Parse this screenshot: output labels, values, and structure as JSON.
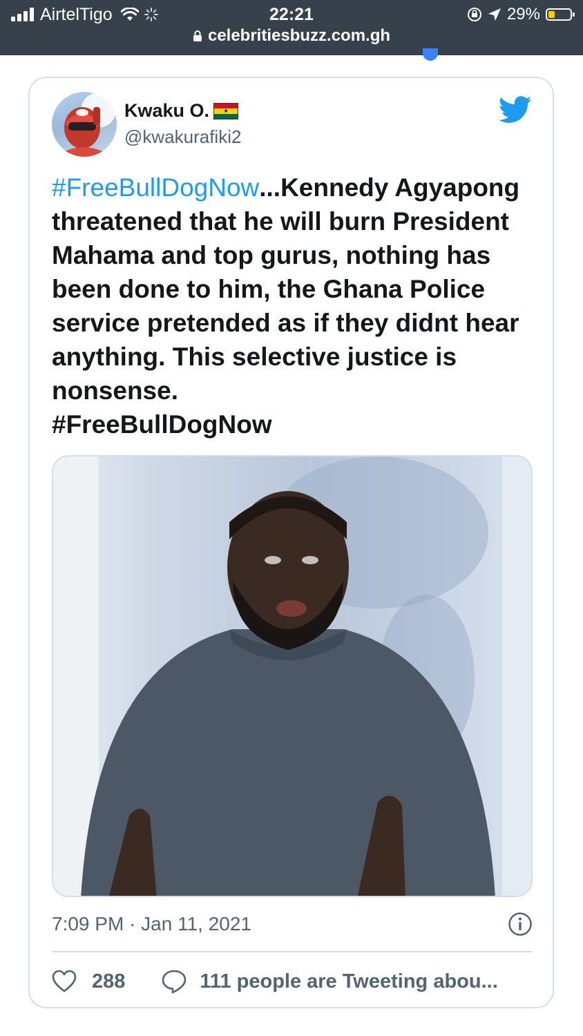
{
  "status_bar": {
    "carrier": "AirtelTigo",
    "time": "22:21",
    "battery_percent": "29%",
    "battery_level": 0.29
  },
  "browser": {
    "address": "celebritiesbuzz.com.gh"
  },
  "tweet": {
    "author_name": "Kwaku O.",
    "author_flag": "ghana-flag-icon",
    "handle": "@kwakurafiki2",
    "hashtag_lead": "#FreeBullDogNow",
    "body": "...Kennedy Agyapong threatened that he will burn President Mahama and  top gurus, nothing has been done to him, the Ghana Police service pretended as if they didnt hear anything. This selective justice is nonsense.",
    "hashtag_tail": "#FreeBullDogNow",
    "timestamp": "7:09 PM · Jan 11, 2021",
    "likes": "288",
    "replies_text": "111 people are Tweeting abou..."
  },
  "colors": {
    "hashtag": "#1d9bf0",
    "twitter_blue": "#1d9bf0",
    "status_bar_bg": "#37414c",
    "meta_text": "#536471"
  }
}
